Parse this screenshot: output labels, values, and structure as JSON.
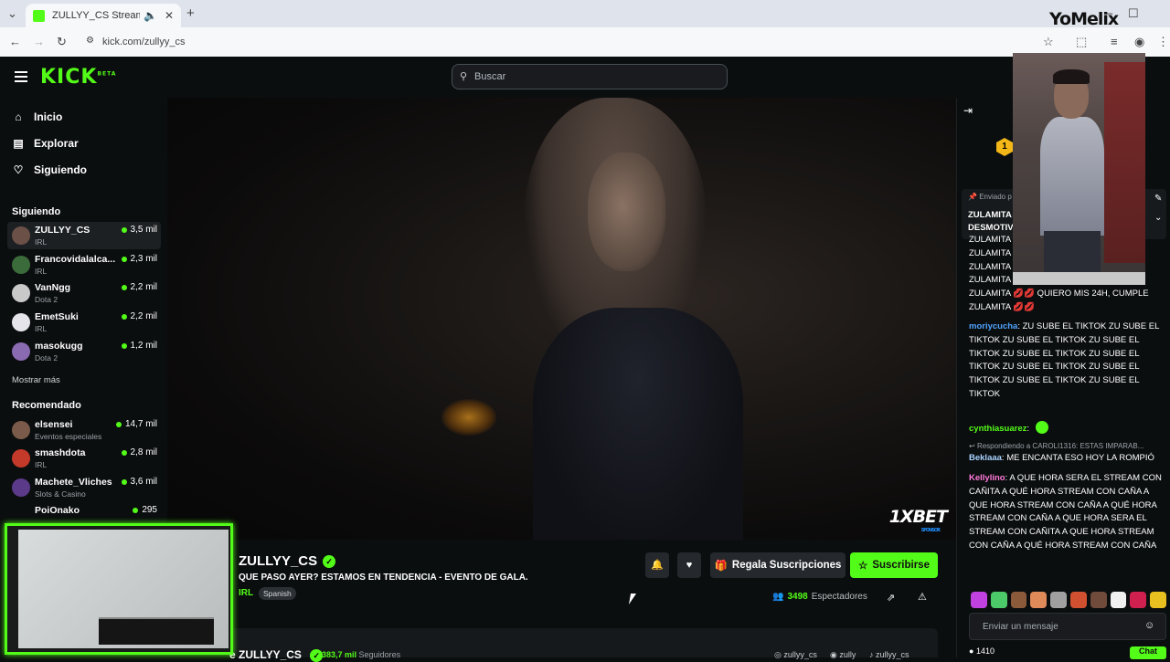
{
  "browser": {
    "tab_title": "ZULLYY_CS Stream - Watch",
    "tab_close": "✕",
    "new_tab": "+",
    "url": "kick.com/zullyy_cs",
    "watermark": "YoMelix"
  },
  "kick": {
    "logo": "KICK",
    "logo_badge": "BETA",
    "search_placeholder": "Buscar"
  },
  "sidebar": {
    "nav": [
      {
        "label": "Inicio",
        "icon": "home-icon"
      },
      {
        "label": "Explorar",
        "icon": "explore-icon"
      },
      {
        "label": "Siguiendo",
        "icon": "heart-icon"
      }
    ],
    "following_title": "Siguiendo",
    "following": [
      {
        "name": "ZULLYY_CS",
        "category": "IRL",
        "viewers": "3,5 mil"
      },
      {
        "name": "Francovidalalca...",
        "category": "IRL",
        "viewers": "2,3 mil"
      },
      {
        "name": "VanNgg",
        "category": "Dota 2",
        "viewers": "2,2 mil"
      },
      {
        "name": "EmetSuki",
        "category": "IRL",
        "viewers": "2,2 mil"
      },
      {
        "name": "masokugg",
        "category": "Dota 2",
        "viewers": "1,2 mil"
      }
    ],
    "show_more": "Mostrar más",
    "recommended_title": "Recomendado",
    "recommended": [
      {
        "name": "elsensei",
        "category": "Eventos especiales",
        "viewers": "14,7 mil"
      },
      {
        "name": "smashdota",
        "category": "IRL",
        "viewers": "2,8 mil"
      },
      {
        "name": "Machete_Vliches",
        "category": "Slots & Casino",
        "viewers": "3,6 mil"
      },
      {
        "name": "PoiOnako",
        "category": "",
        "viewers": "295"
      }
    ]
  },
  "video": {
    "sponsor": "1XBET",
    "sponsor_sub": "SPONSOR"
  },
  "stream": {
    "channel": "ZULLYY_CS",
    "title": "QUE PASO AYER? ESTAMOS EN TENDENCIA - EVENTO DE GALA.",
    "category": "IRL",
    "language": "Spanish",
    "gift_label": "Regala Suscripciones",
    "subscribe_label": "Suscribirse",
    "viewers_count": "3498",
    "viewers_label": "Espectadores"
  },
  "about": {
    "name": "ZULLYY_CS",
    "followers_count": "383,7 mil",
    "followers_label": "Seguidores",
    "socials": [
      "zullyy_cs",
      "zully",
      "zullyy_cs"
    ]
  },
  "chat": {
    "pinned_label": "Enviado p",
    "pinned_text": "ZULAMITA\nDESMOTIV",
    "messages": [
      {
        "user": "",
        "text": "ZULAMITA"
      },
      {
        "user": "",
        "text": "ZULAMITA"
      },
      {
        "user": "",
        "text": "ZULAMITA"
      },
      {
        "user": "",
        "text": "ZULAMITA"
      },
      {
        "user": "",
        "text": "ZULAMITA 💋💋 QUIERO MIS 24H, CUMPLE ZULAMITA 💋💋"
      },
      {
        "user": "moriycucha",
        "text": "ZU SUBE EL TIKTOK ZU SUBE EL TIKTOK ZU SUBE EL TIKTOK ZU SUBE EL TIKTOK ZU SUBE EL TIKTOK ZU SUBE EL TIKTOK ZU SUBE EL TIKTOK ZU SUBE EL TIKTOK ZU SUBE EL TIKTOK ZU SUBE EL TIKTOK"
      },
      {
        "user": "cynthiasuarez",
        "text": ""
      },
      {
        "user": "Beklaaa",
        "text": "ME ENCANTA ESO HOY LA ROMPIÓ"
      },
      {
        "user": "Kellylino",
        "text": "A QUE HORA SERA EL STREAM CON CAÑITA A QUÉ HORA STREAM CON CAÑA A QUE HORA STREAM CON CAÑA A QUÉ HORA STREAM CON CAÑA A QUE HORA SERA EL STREAM CON CAÑITA A QUE HORA STREAM CON CAÑA A QUÉ HORA STREAM CON CAÑA"
      }
    ],
    "reply_note": "Respondiendo a CAROLI1316: ESTAS IMPARAB...",
    "input_placeholder": "Enviar un mensaje",
    "bottom_count": "1410",
    "send_label": "Chat",
    "colors": {
      "moriycucha": "#4fa3ff",
      "cynthiasuarez": "#53fc18",
      "Beklaaa": "#a8d4ff",
      "Kellylino": "#ff7ad9"
    }
  }
}
